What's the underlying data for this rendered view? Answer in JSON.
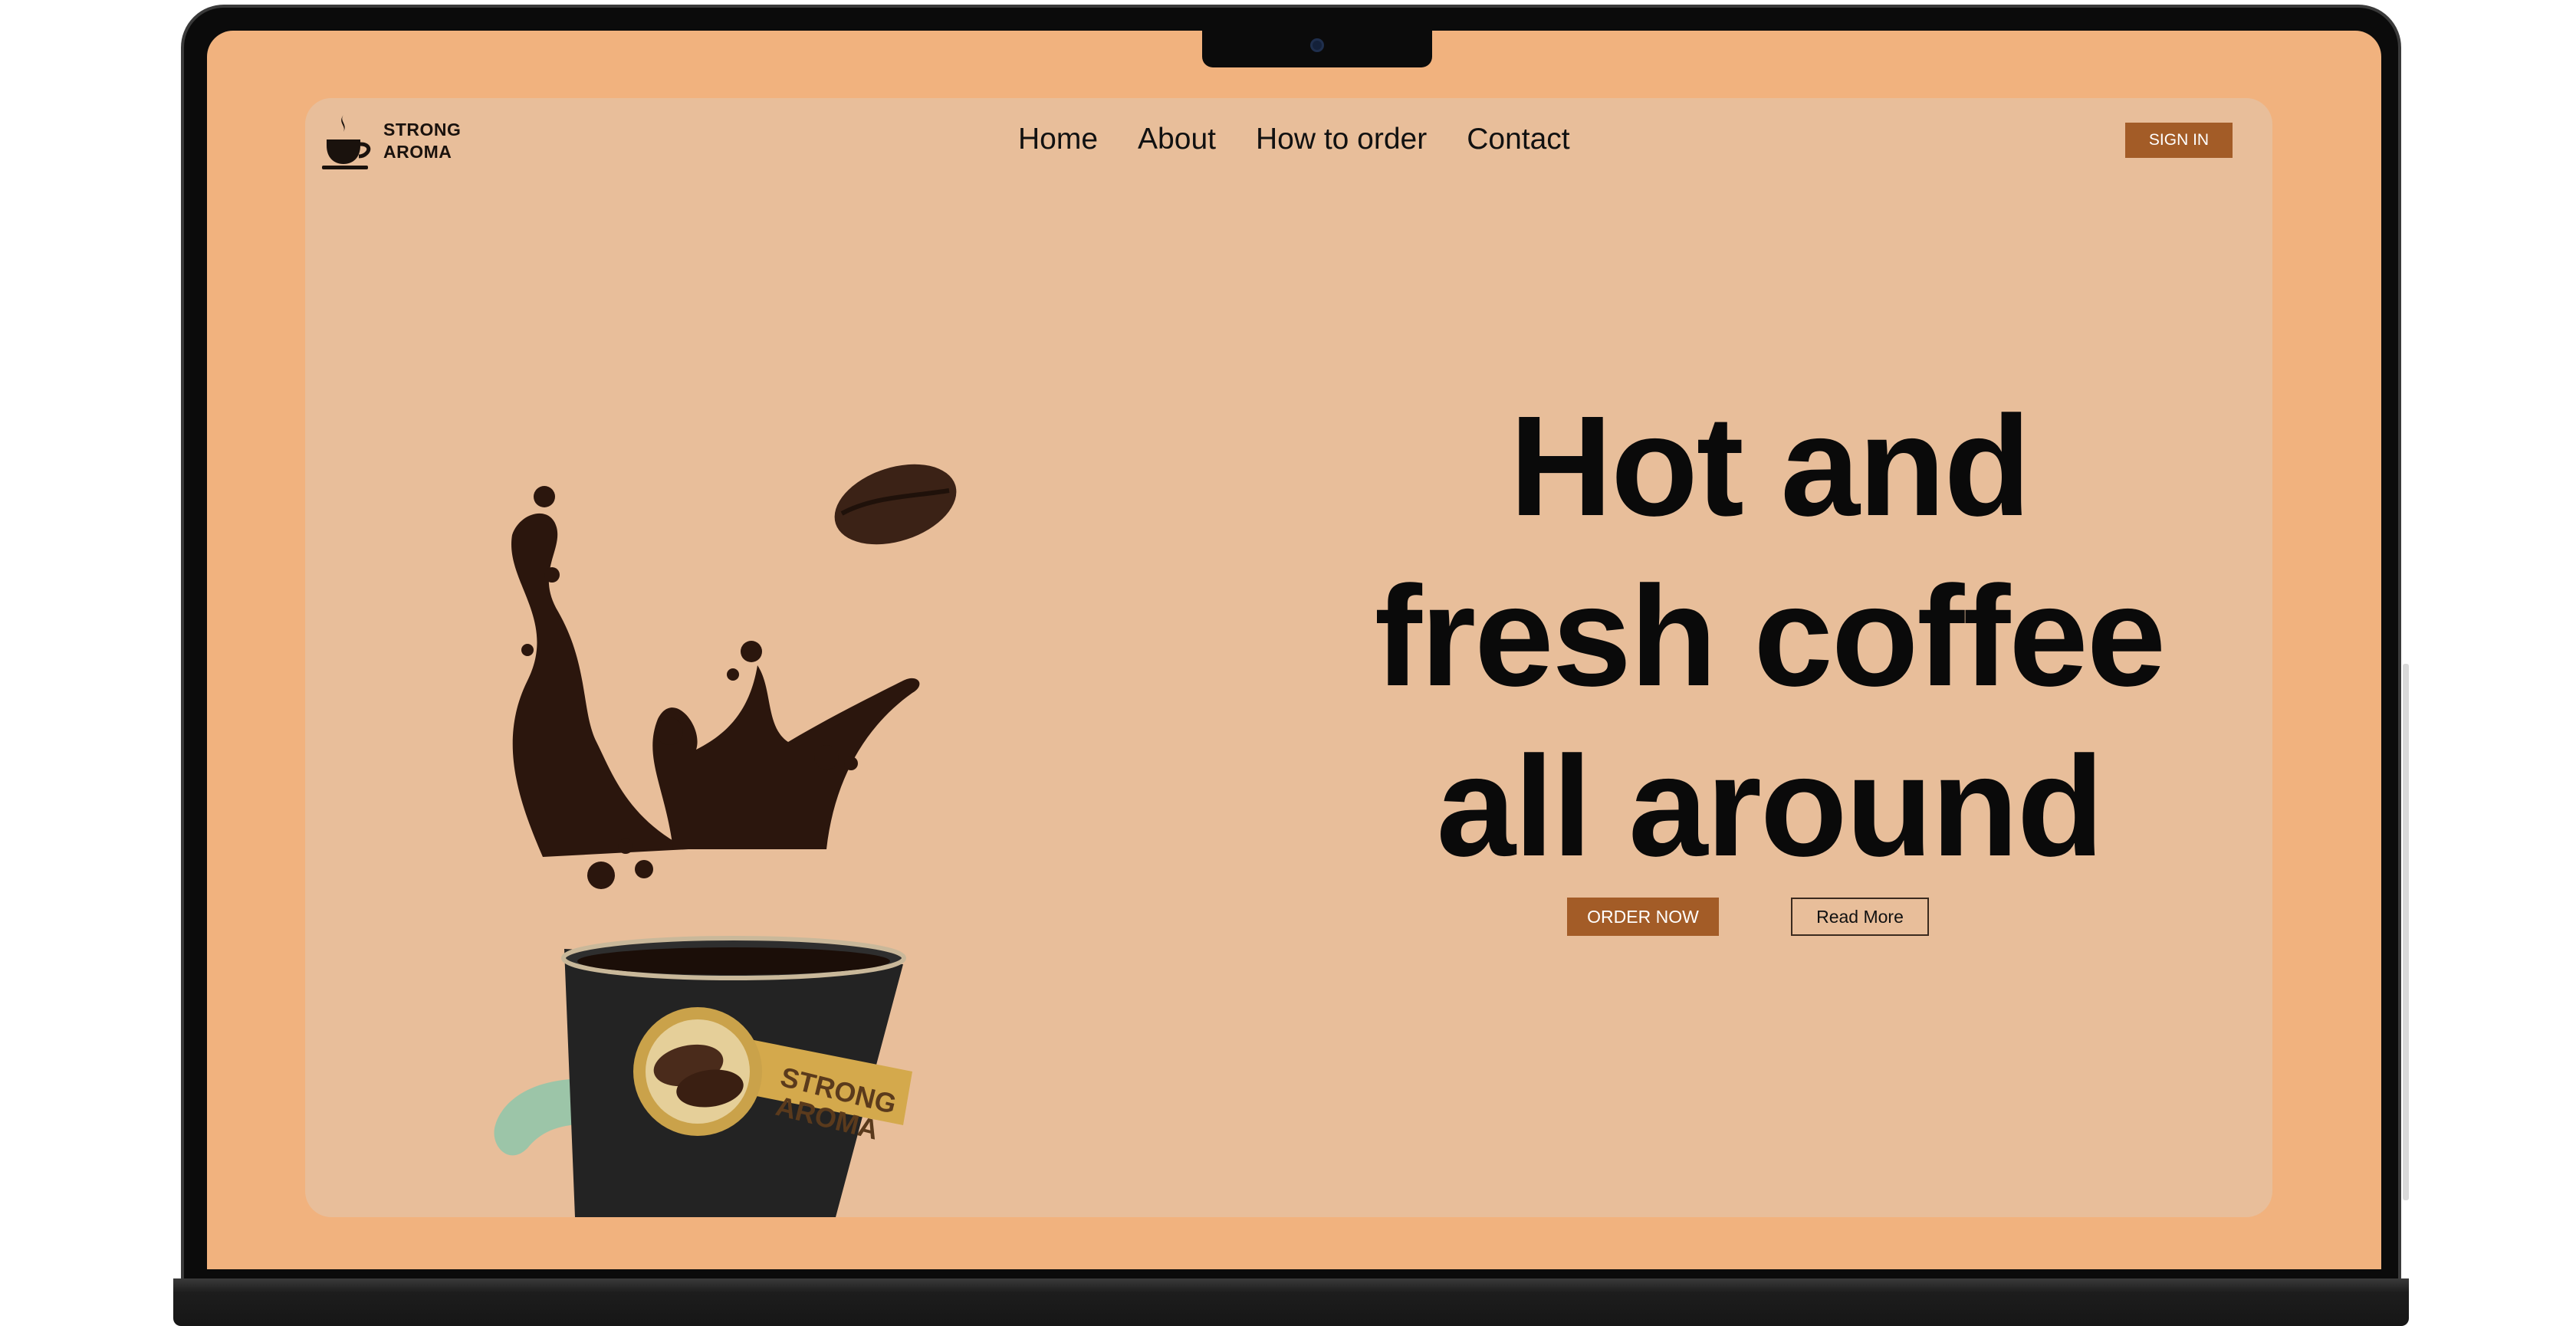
{
  "brand": {
    "line1": "STRONG",
    "line2": "AROMA",
    "icon": "coffee-cup-icon"
  },
  "nav": {
    "items": [
      {
        "label": "Home"
      },
      {
        "label": "About"
      },
      {
        "label": "How to order"
      },
      {
        "label": "Contact"
      }
    ],
    "signin_label": "SIGN IN"
  },
  "hero": {
    "title_lines": [
      "Hot and",
      "fresh coffee",
      "all around"
    ],
    "order_label": "ORDER NOW",
    "read_more_label": "Read More",
    "cup_label_line1": "STRONG",
    "cup_label_line2": "AROMA"
  },
  "colors": {
    "screen_bg": "#f1b27e",
    "page_bg": "#e8be9a",
    "accent_brown": "#a35c27",
    "coffee": "#2b160d",
    "cup": "#232323"
  }
}
